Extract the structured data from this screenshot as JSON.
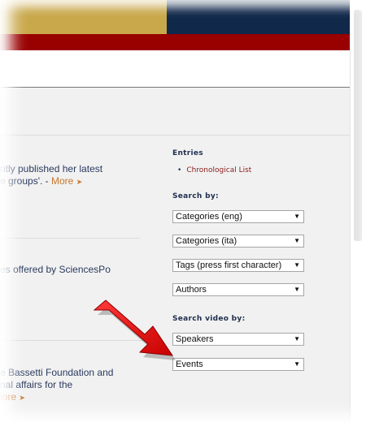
{
  "colors": {
    "gold": "#c9a84b",
    "navy": "#10284a",
    "red": "#990000",
    "link": "#8b1a1a",
    "more": "#c8762d",
    "text": "#2a3a5e"
  },
  "main": {
    "posts": [
      {
        "line1": "ntly published her latest",
        "line2": "e groups'. - ",
        "more": "More",
        "arrow": "➤"
      },
      {
        "line1": "es offered by SciencesPo"
      },
      {
        "line1": "e Bassetti Foundation and",
        "line2": "nal affairs for the",
        "more": "lore",
        "arrow": "➤"
      }
    ]
  },
  "sidebar": {
    "entries_heading": "Entries",
    "entries_items": [
      {
        "label": "Chronological List"
      }
    ],
    "search_heading": "Search by:",
    "search_selects": [
      {
        "value": "Categories (eng)"
      },
      {
        "value": "Categories (ita)"
      },
      {
        "value": "Tags (press first character)"
      },
      {
        "value": "Authors"
      }
    ],
    "video_heading": "Search video by:",
    "video_selects": [
      {
        "value": "Speakers"
      },
      {
        "value": "Events"
      }
    ],
    "chevron_icon": "chevron-down-icon"
  },
  "annotation": {
    "arrow_icon": "red-pointer-arrow-icon"
  }
}
